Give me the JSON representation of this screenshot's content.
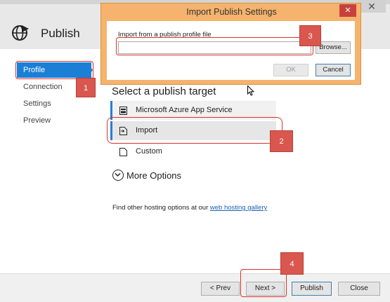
{
  "window": {
    "close_glyph": "✕",
    "page_title": "Publish",
    "page_icon": "globe-publish-icon"
  },
  "nav": {
    "items": [
      {
        "label": "Profile",
        "selected": true
      },
      {
        "label": "Connection",
        "selected": false
      },
      {
        "label": "Settings",
        "selected": false
      },
      {
        "label": "Preview",
        "selected": false
      }
    ]
  },
  "main": {
    "heading": "Select a publish target",
    "targets": [
      {
        "label": "Microsoft Azure App Service",
        "icon": "azure-app-service-icon"
      },
      {
        "label": "Import",
        "icon": "import-file-icon"
      },
      {
        "label": "Custom",
        "icon": "custom-file-icon"
      }
    ],
    "more_options": "More Options",
    "hosting_text": "Find other hosting options at our ",
    "hosting_link": "web hosting gallery"
  },
  "footer": {
    "prev": "< Prev",
    "next": "Next >",
    "publish": "Publish",
    "close": "Close"
  },
  "dialog": {
    "title": "Import Publish Settings",
    "close_glyph": "✕",
    "field_label": "Import from a publish profile file",
    "field_value": "",
    "browse": "Browse...",
    "ok": "OK",
    "cancel": "Cancel"
  },
  "callouts": [
    "1",
    "2",
    "3",
    "4"
  ],
  "colors": {
    "accent": "#1c7fd6",
    "annotation": "#d9302b",
    "dialog_frame": "#f5b36d",
    "callout_fill": "#d9574f"
  }
}
